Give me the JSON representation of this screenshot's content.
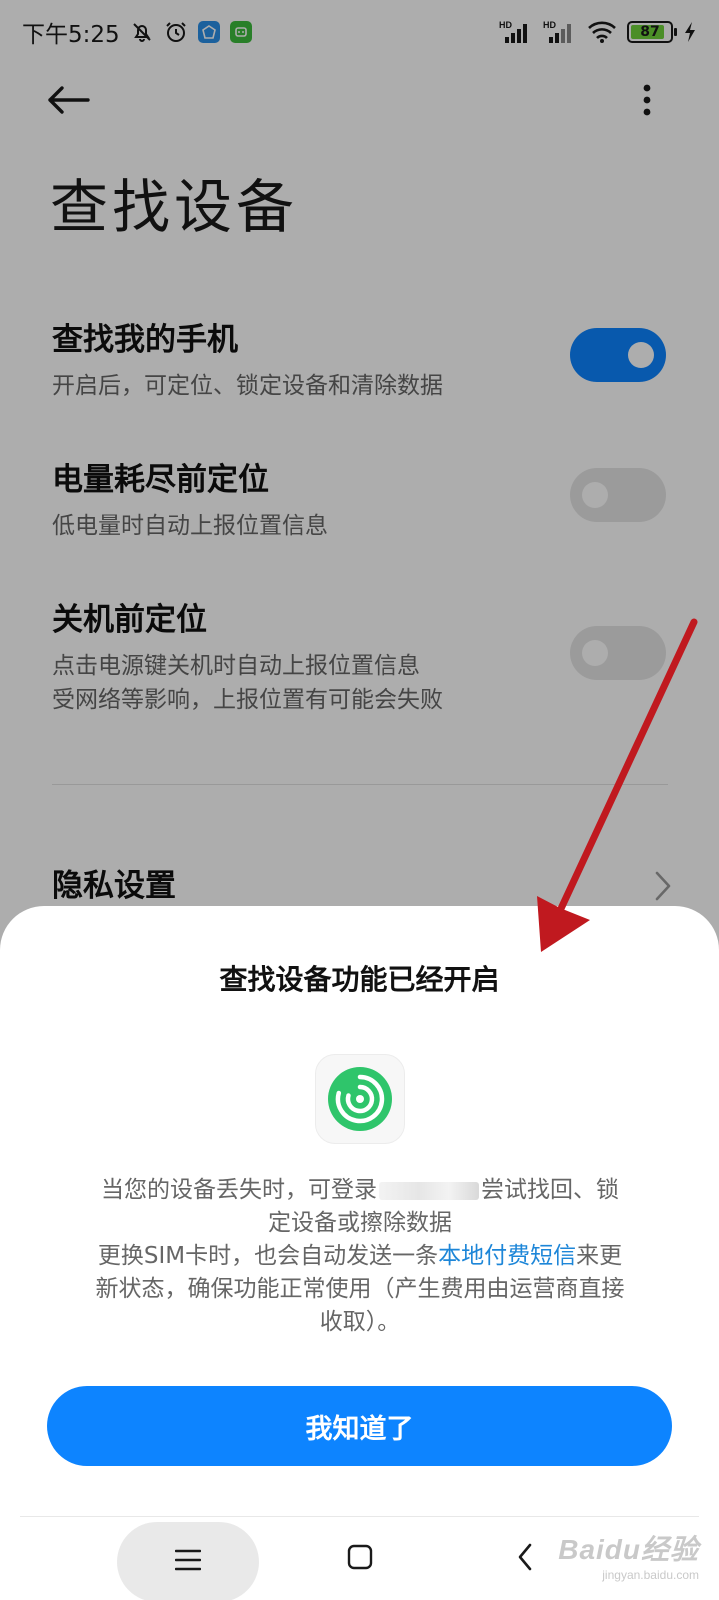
{
  "status_bar": {
    "time": "下午5:25",
    "network1": "HD",
    "network2": "HD",
    "battery_level": "87",
    "battery_fraction": 0.87,
    "battery_color": "#6fd13a",
    "icons": [
      "bell-muted-icon",
      "alarm-icon",
      "blue-app-icon",
      "green-app-icon",
      "signal-icon",
      "wifi-icon",
      "battery-icon",
      "charging-icon"
    ]
  },
  "toolbar": {
    "back_icon": "arrow-left-icon",
    "more_icon": "more-vertical-icon"
  },
  "page": {
    "title": "查找设备"
  },
  "settings": [
    {
      "label": "查找我的手机",
      "desc1": "开启后，可定位、锁定设备和清除数据",
      "desc2": "",
      "enabled": true
    },
    {
      "label": "电量耗尽前定位",
      "desc1": "低电量时自动上报位置信息",
      "desc2": "",
      "enabled": false
    },
    {
      "label": "关机前定位",
      "desc1": "点击电源键关机时自动上报位置信息",
      "desc2": "受网络等影响，上报位置有可能会失败",
      "enabled": false
    }
  ],
  "privacy": {
    "label": "隐私设置"
  },
  "colors": {
    "accent": "#0d84ff",
    "toggle_on": "#0d84ff",
    "toggle_off": "#e5e5e5",
    "link": "#1d86d8",
    "arrow": "#c0191f",
    "app_icon": "#2fc56b"
  },
  "dialog": {
    "title": "查找设备功能已经开启",
    "line1_prefix": "当您的设备丢失时，可登录",
    "line1_suffix": "尝试找回、锁",
    "line2": "定设备或擦除数据",
    "line3_prefix": "更换SIM卡时，也会自动发送一条",
    "line3_link": "本地付费短信",
    "line3_suffix": "来更",
    "line4": "新状态，确保功能正常使用（产生费用由运营商直接",
    "line5": "收取）。",
    "confirm_label": "我知道了"
  },
  "nav": {
    "menu_icon": "menu-icon",
    "home_icon": "home-square-icon",
    "back_icon": "back-chevron-icon"
  },
  "watermark": {
    "main": "Baidu经验",
    "sub": "jingyan.baidu.com"
  }
}
